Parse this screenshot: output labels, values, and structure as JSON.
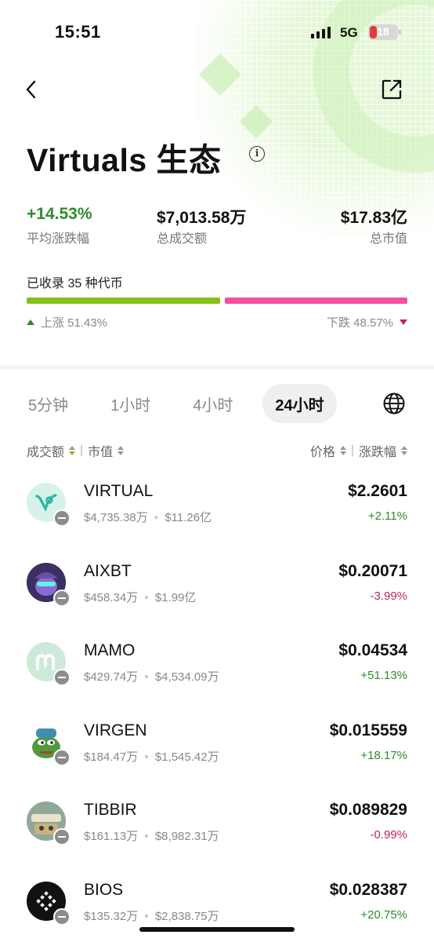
{
  "status_bar": {
    "time": "15:51",
    "network": "5G",
    "battery": "18"
  },
  "header": {
    "title": "Virtuals 生态",
    "info_icon": "i"
  },
  "stats": [
    {
      "value": "+14.53%",
      "label": "平均涨跌幅"
    },
    {
      "value": "$7,013.58万",
      "label": "总成交额"
    },
    {
      "value": "$17.83亿",
      "label": "总市值"
    }
  ],
  "breadth": {
    "count_text": "已收录 35 种代币",
    "up_label": "上涨 51.43%",
    "down_label": "下跌 48.57%",
    "up_fraction": 0.5143,
    "down_fraction": 0.4857,
    "up_color": "#85c116",
    "down_color": "#f54fa0"
  },
  "tabs": [
    "5分钟",
    "1小时",
    "4小时",
    "24小时"
  ],
  "active_tab": "24小时",
  "sort": {
    "volume": "成交额",
    "market_cap": "市值",
    "price": "价格",
    "change": "涨跌幅",
    "divider": "|"
  },
  "tokens": [
    {
      "symbol": "VIRTUAL",
      "volume": "$4,735.38万",
      "market_cap": "$11.26亿",
      "price": "$2.2601",
      "change": "+2.11%",
      "direction": "up"
    },
    {
      "symbol": "AIXBT",
      "volume": "$458.34万",
      "market_cap": "$1.99亿",
      "price": "$0.20071",
      "change": "-3.99%",
      "direction": "down"
    },
    {
      "symbol": "MAMO",
      "volume": "$429.74万",
      "market_cap": "$4,534.09万",
      "price": "$0.04534",
      "change": "+51.13%",
      "direction": "up"
    },
    {
      "symbol": "VIRGEN",
      "volume": "$184.47万",
      "market_cap": "$1,545.42万",
      "price": "$0.015559",
      "change": "+18.17%",
      "direction": "up"
    },
    {
      "symbol": "TIBBIR",
      "volume": "$161.13万",
      "market_cap": "$8,982.31万",
      "price": "$0.089829",
      "change": "-0.99%",
      "direction": "down"
    },
    {
      "symbol": "BIOS",
      "volume": "$135.32万",
      "market_cap": "$2,838.75万",
      "price": "$0.028387",
      "change": "+20.75%",
      "direction": "up"
    }
  ],
  "dot_separator": "•",
  "colors": {
    "up": "#2e8b2a",
    "down": "#c2235e",
    "accent_green": "#85c116"
  }
}
